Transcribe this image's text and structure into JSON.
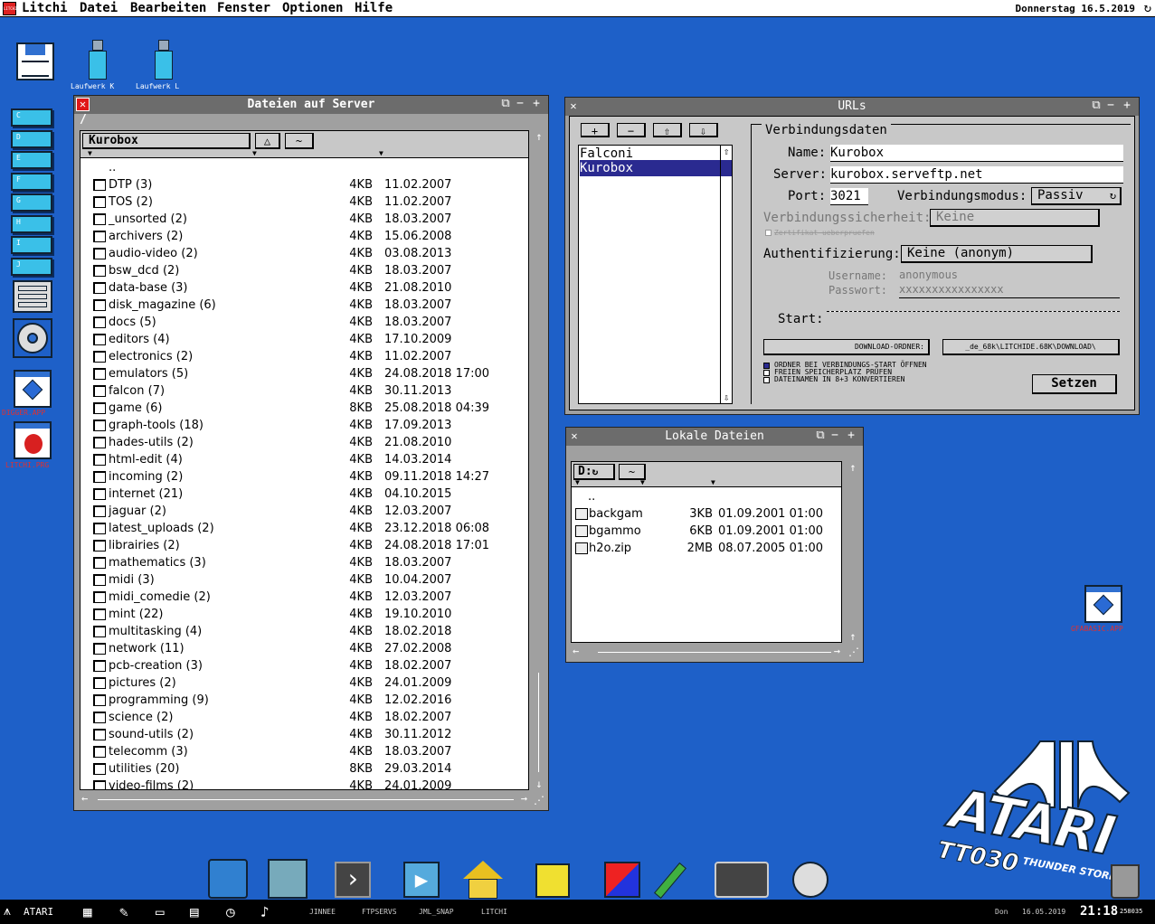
{
  "menubar": {
    "items": [
      "Litchi",
      "Datei",
      "Bearbeiten",
      "Fenster",
      "Optionen",
      "Hilfe"
    ],
    "date": "Donnerstag 16.5.2019",
    "sync_icon": "sync-icon",
    "logo_text": "LITCHI"
  },
  "desktop": {
    "drives": [
      {
        "label": "Laufwerk K",
        "letter": "K"
      },
      {
        "label": "Laufwerk L",
        "letter": "L"
      }
    ],
    "partition_letters": [
      "C",
      "D",
      "E",
      "F",
      "G",
      "H",
      "I",
      "J"
    ],
    "left_apps": [
      "DIGGER.APP",
      "LITCHI.PRG"
    ],
    "right_app": "GFABASIC.APP"
  },
  "server_window": {
    "title": "Dateien auf Server",
    "path": "/",
    "column_header": "Kurobox",
    "sort_btn": "△",
    "tilde_btn": "~",
    "parent": "..",
    "files": [
      {
        "name": "DTP (3)",
        "size": "4KB",
        "date": "11.02.2007"
      },
      {
        "name": "TOS (2)",
        "size": "4KB",
        "date": "11.02.2007"
      },
      {
        "name": "_unsorted (2)",
        "size": "4KB",
        "date": "18.03.2007"
      },
      {
        "name": "archivers (2)",
        "size": "4KB",
        "date": "15.06.2008"
      },
      {
        "name": "audio-video (2)",
        "size": "4KB",
        "date": "03.08.2013"
      },
      {
        "name": "bsw_dcd (2)",
        "size": "4KB",
        "date": "18.03.2007"
      },
      {
        "name": "data-base (3)",
        "size": "4KB",
        "date": "21.08.2010"
      },
      {
        "name": "disk_magazine (6)",
        "size": "4KB",
        "date": "18.03.2007"
      },
      {
        "name": "docs (5)",
        "size": "4KB",
        "date": "18.03.2007"
      },
      {
        "name": "editors (4)",
        "size": "4KB",
        "date": "17.10.2009"
      },
      {
        "name": "electronics (2)",
        "size": "4KB",
        "date": "11.02.2007"
      },
      {
        "name": "emulators (5)",
        "size": "4KB",
        "date": "24.08.2018 17:00"
      },
      {
        "name": "falcon (7)",
        "size": "4KB",
        "date": "30.11.2013"
      },
      {
        "name": "game (6)",
        "size": "8KB",
        "date": "25.08.2018 04:39"
      },
      {
        "name": "graph-tools (18)",
        "size": "4KB",
        "date": "17.09.2013"
      },
      {
        "name": "hades-utils (2)",
        "size": "4KB",
        "date": "21.08.2010"
      },
      {
        "name": "html-edit (4)",
        "size": "4KB",
        "date": "14.03.2014"
      },
      {
        "name": "incoming (2)",
        "size": "4KB",
        "date": "09.11.2018 14:27"
      },
      {
        "name": "internet (21)",
        "size": "4KB",
        "date": "04.10.2015"
      },
      {
        "name": "jaguar (2)",
        "size": "4KB",
        "date": "12.03.2007"
      },
      {
        "name": "latest_uploads (2)",
        "size": "4KB",
        "date": "23.12.2018 06:08"
      },
      {
        "name": "librairies (2)",
        "size": "4KB",
        "date": "24.08.2018 17:01"
      },
      {
        "name": "mathematics (3)",
        "size": "4KB",
        "date": "18.03.2007"
      },
      {
        "name": "midi (3)",
        "size": "4KB",
        "date": "10.04.2007"
      },
      {
        "name": "midi_comedie (2)",
        "size": "4KB",
        "date": "12.03.2007"
      },
      {
        "name": "mint (22)",
        "size": "4KB",
        "date": "19.10.2010"
      },
      {
        "name": "multitasking (4)",
        "size": "4KB",
        "date": "18.02.2018"
      },
      {
        "name": "network (11)",
        "size": "4KB",
        "date": "27.02.2008"
      },
      {
        "name": "pcb-creation (3)",
        "size": "4KB",
        "date": "18.02.2007"
      },
      {
        "name": "pictures (2)",
        "size": "4KB",
        "date": "24.01.2009"
      },
      {
        "name": "programming (9)",
        "size": "4KB",
        "date": "12.02.2016"
      },
      {
        "name": "science (2)",
        "size": "4KB",
        "date": "18.02.2007"
      },
      {
        "name": "sound-utils (2)",
        "size": "4KB",
        "date": "30.11.2012"
      },
      {
        "name": "telecomm (3)",
        "size": "4KB",
        "date": "18.03.2007"
      },
      {
        "name": "utilities (20)",
        "size": "8KB",
        "date": "29.03.2014"
      },
      {
        "name": "video-films (2)",
        "size": "4KB",
        "date": "24.01.2009"
      }
    ]
  },
  "urls_window": {
    "title": "URLs",
    "toolbar": [
      "+",
      "−",
      "⇧",
      "⇩"
    ],
    "list": [
      "Falconi",
      "Kurobox"
    ],
    "selected": "Kurobox",
    "group_title": "Verbindungsdaten",
    "name_label": "Name:",
    "name_value": "Kurobox",
    "server_label": "Server:",
    "server_value": "kurobox.serveftp.net",
    "port_label": "Port:",
    "port_value": "3021",
    "mode_label": "Verbindungsmodus:",
    "mode_value": "Passiv",
    "security_label": "Verbindungssicherheit:",
    "security_value": "Keine",
    "cert_text": "Zertifikat ueberpruefen",
    "auth_label": "Authentifizierung:",
    "auth_value": "Keine (anonym)",
    "user_label": "Username:",
    "user_value": "anonymous",
    "pass_label": "Passwort:",
    "pass_value": "xxxxxxxxxxxxxxxx",
    "start_label": "Start:",
    "start_value": "",
    "download_label": "DOWNLOAD-ORDNER:",
    "download_value": "_de_68k\\LITCHIDE.68K\\DOWNLOAD\\",
    "options": [
      "ORDNER BEI VERBINDUNGS-START ÖFFNEN",
      "FREIEN SPEICHERPLATZ PRÜFEN",
      "DATEINAMEN IN 8+3 KONVERTIEREN"
    ],
    "set_button": "Setzen"
  },
  "local_window": {
    "title": "Lokale Dateien",
    "drive": "D:",
    "tilde_btn": "~",
    "parent": "..",
    "files": [
      {
        "name": "backgam",
        "size": "3KB",
        "date": "01.09.2001 01:00"
      },
      {
        "name": "bgammo",
        "size": "6KB",
        "date": "01.09.2001 01:00"
      },
      {
        "name": "h2o.zip",
        "size": "2MB",
        "date": "08.07.2005 01:00"
      }
    ]
  },
  "logo": {
    "brand": "ATARI",
    "model": "TT030",
    "sub": "THUNDER STORM"
  },
  "taskbar": {
    "start_label": "ATARI",
    "apps": [
      "JINNEE",
      "FTPSERVS",
      "JML_SNAP",
      "LITCHI"
    ],
    "day": "Don",
    "date": "16.05.2019",
    "time": "21:18",
    "mem": "258035"
  }
}
